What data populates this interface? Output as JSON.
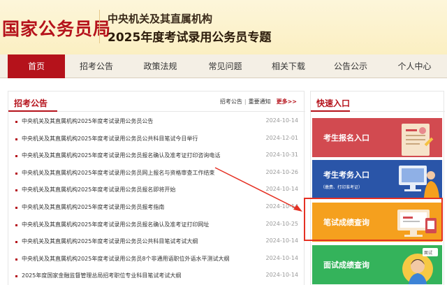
{
  "header": {
    "logo": "国家公务员局",
    "subtitle1": "中央机关及其直属机构",
    "subtitle2": "2025年度考试录用公务员专题"
  },
  "nav": [
    {
      "label": "首页",
      "active": true
    },
    {
      "label": "招考公告",
      "active": false
    },
    {
      "label": "政策法规",
      "active": false
    },
    {
      "label": "常见问题",
      "active": false
    },
    {
      "label": "相关下载",
      "active": false
    },
    {
      "label": "公告公示",
      "active": false
    },
    {
      "label": "个人中心",
      "active": false
    }
  ],
  "announcements": {
    "title": "招考公告",
    "link1": "招考公告",
    "separator": "|",
    "link2": "重要通知",
    "more": "更多>>",
    "items": [
      {
        "title": "中央机关及其直属机构2025年度考试录用公务员公告",
        "date": "2024-10-14"
      },
      {
        "title": "中央机关及其直属机构2025年度考试录用公务员公共科目笔试今日举行",
        "date": "2024-12-01"
      },
      {
        "title": "中央机关及其直属机构2025年度考试录用公务员报名确认及准考证打印咨询电话",
        "date": "2024-10-31"
      },
      {
        "title": "中央机关及其直属机构2025年度考试录用公务员网上报名与资格审查工作结束",
        "date": "2024-10-26"
      },
      {
        "title": "中央机关及其直属机构2025年度考试录用公务员报名即将开始",
        "date": "2024-10-14"
      },
      {
        "title": "中央机关及其直属机构2025年度考试录用公务员报考指南",
        "date": "2024-10-14"
      },
      {
        "title": "中央机关及其直属机构2025年度考试录用公务员报名确认及准考证打印网址",
        "date": "2024-10-25"
      },
      {
        "title": "中央机关及其直属机构2025年度考试录用公务员公共科目笔试考试大纲",
        "date": "2024-10-14"
      },
      {
        "title": "中央机关及其直属机构2025年度考试录用公务员8个非通用语职位外语水平测试大纲",
        "date": "2024-10-14"
      },
      {
        "title": "2025年度国家金融监督管理总局招考职位专业科目笔试考试大纲",
        "date": "2024-10-14"
      }
    ]
  },
  "quick": {
    "title": "快速入口",
    "cards": [
      {
        "label": "考生报名入口",
        "sub": ""
      },
      {
        "label": "考生考务入口",
        "sub": "（缴费、打印准考证）"
      },
      {
        "label": "笔试成绩查询",
        "sub": ""
      },
      {
        "label": "面试成绩查询",
        "sub": "面试"
      }
    ]
  },
  "colors": {
    "brand_red": "#b5121b",
    "card_red": "#d24a50",
    "card_blue": "#2a55a8",
    "card_orange": "#f5a01e",
    "card_green": "#34b35b",
    "highlight": "#e53124"
  }
}
